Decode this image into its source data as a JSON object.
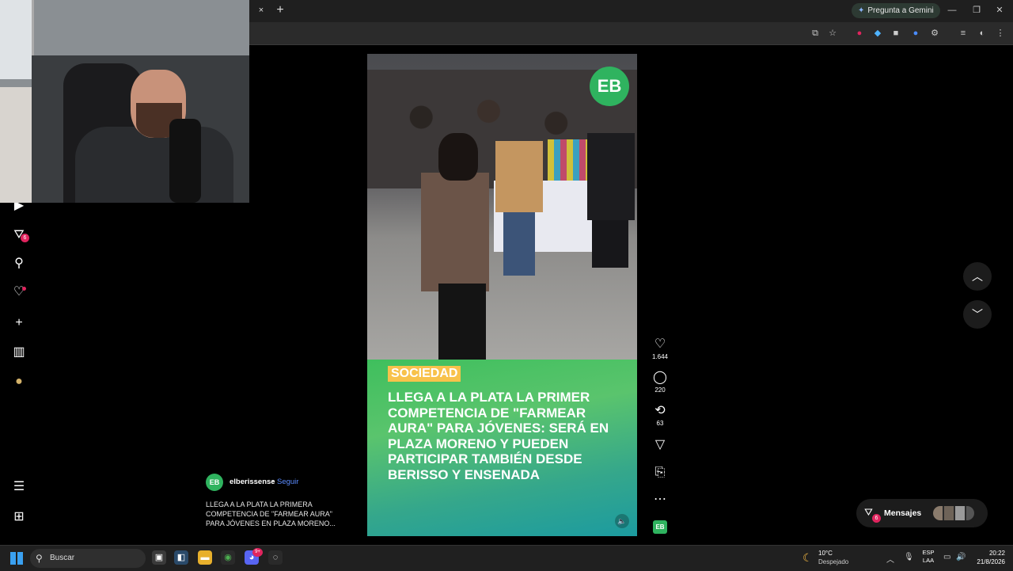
{
  "browser": {
    "gemini_label": "Pregunta a Gemini",
    "new_tab": "+",
    "tab_close": "×"
  },
  "left_nav": {
    "filter_badge": "6"
  },
  "video": {
    "logo_text": "EB",
    "tag": "SOCIEDAD",
    "headline": "LLEGA A LA PLATA LA PRIMER COMPETENCIA DE \"FARMEAR AURA\" PARA JÓVENES: SERÁ EN PLAZA MORENO Y PUEDEN PARTICIPAR TAMBIÉN DESDE BERISSO Y ENSENADA"
  },
  "actions": {
    "likes": "1.644",
    "comments": "220",
    "reposts": "63"
  },
  "post": {
    "avatar_text": "EB",
    "username": "elberissense",
    "separator": "•",
    "follow_label": "Seguir",
    "description": "LLEGA A LA PLATA LA PRIMERA COMPETENCIA DE \"FARMEAR AURA\" PARA JÓVENES EN PLAZA MORENO..."
  },
  "messages": {
    "label": "Mensajes",
    "badge": "6"
  },
  "taskbar": {
    "search_placeholder": "Buscar",
    "discord_badge": "9+",
    "weather_temp": "10°C",
    "weather_desc": "Despejado",
    "lang_line1": "ESP",
    "lang_line2": "LAA",
    "time": "20:22",
    "date": "21/8/2026"
  }
}
